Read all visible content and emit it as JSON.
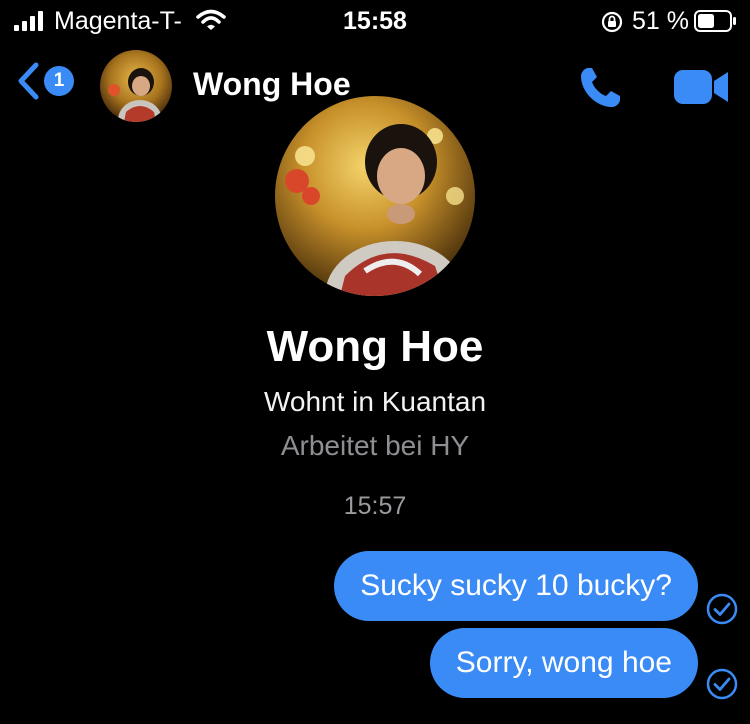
{
  "status_bar": {
    "carrier": "Magenta-T-",
    "time": "15:58",
    "battery": "51 %"
  },
  "header": {
    "back_badge": "1",
    "contact_name": "Wong Hoe"
  },
  "profile": {
    "name": "Wong Hoe",
    "location": "Wohnt in Kuantan",
    "work": "Arbeitet bei HY"
  },
  "conversation": {
    "timestamp": "15:57",
    "messages": [
      {
        "text": "Sucky sucky 10 bucky?",
        "status": "sent"
      },
      {
        "text": "Sorry, wong hoe",
        "status": "sent"
      }
    ]
  },
  "colors": {
    "accent": "#3a8bf5",
    "background": "#000000",
    "secondary_text": "#8e8e93"
  }
}
